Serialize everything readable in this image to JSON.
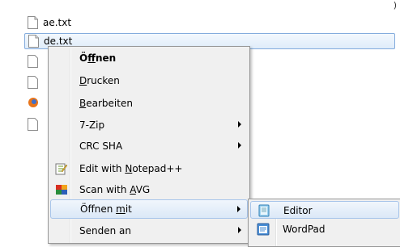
{
  "files": [
    {
      "name": "ae.txt",
      "selected": false
    },
    {
      "name": "de.txt",
      "selected": true
    }
  ],
  "context_menu": {
    "items": [
      {
        "prefix": "Ö",
        "accel": "f",
        "suffix": "fnen",
        "bold": true,
        "submenu": false,
        "icon": ""
      },
      {
        "prefix": "",
        "accel": "D",
        "suffix": "rucken",
        "bold": false,
        "submenu": false,
        "icon": ""
      },
      {
        "prefix": "",
        "accel": "B",
        "suffix": "earbeiten",
        "bold": false,
        "submenu": false,
        "icon": ""
      },
      {
        "prefix": "7-Zip",
        "accel": "",
        "suffix": "",
        "bold": false,
        "submenu": true,
        "icon": ""
      },
      {
        "prefix": "CRC SHA",
        "accel": "",
        "suffix": "",
        "bold": false,
        "submenu": true,
        "icon": ""
      },
      {
        "prefix": "Edit with ",
        "accel": "N",
        "suffix": "otepad++",
        "bold": false,
        "submenu": false,
        "icon": "notepad-plus-plus-icon"
      },
      {
        "prefix": "Scan with ",
        "accel": "A",
        "suffix": "VG",
        "bold": false,
        "submenu": false,
        "icon": "avg-icon"
      },
      {
        "prefix": "Öffnen ",
        "accel": "m",
        "suffix": "it",
        "bold": false,
        "submenu": true,
        "icon": "",
        "hover": true
      },
      {
        "prefix": "Senden an",
        "accel": "",
        "suffix": "",
        "bold": false,
        "submenu": true,
        "icon": ""
      }
    ]
  },
  "open_with_submenu": {
    "items": [
      {
        "label": "Editor",
        "icon": "notepad-icon",
        "hover": true
      },
      {
        "label": "WordPad",
        "icon": "wordpad-icon",
        "hover": false
      }
    ]
  },
  "colors": {
    "selection_border": "#84acdd",
    "menu_background": "#f0f0f0",
    "hover_border": "#a8c5ea"
  }
}
